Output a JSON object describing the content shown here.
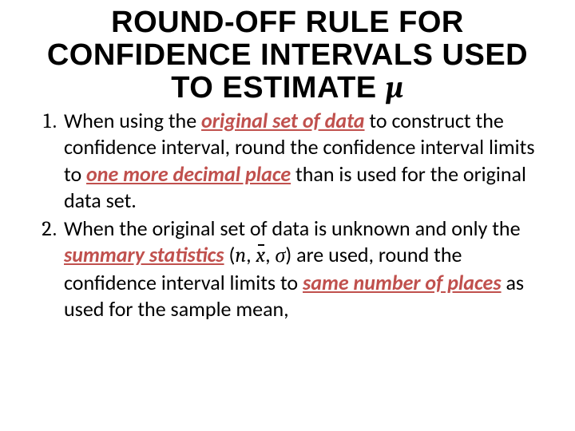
{
  "title": {
    "line1": "ROUND-OFF RULE FOR",
    "line2": "CONFIDENCE INTERVALS USED",
    "line3_prefix": "TO ESTIMATE ",
    "mu": "µ"
  },
  "items": [
    {
      "t1": "When using the ",
      "emph1": "original set of data",
      "t2": " to construct the confidence interval, round the confidence interval limits to ",
      "emph2": "one more decimal place",
      "t3": " than is used for the original data set."
    },
    {
      "t1": "When the original set of data is unknown and only the ",
      "emph1": "summary statistics",
      "paren_open": " (",
      "n": "n",
      "comma1": ", ",
      "xbar": "x",
      "comma2": ", ",
      "sigma": "σ",
      "paren_close": ") ",
      "t2": "are used, round the confidence interval limits to ",
      "emph2": "same number of places",
      "t3": " as used for the sample mean,"
    }
  ]
}
